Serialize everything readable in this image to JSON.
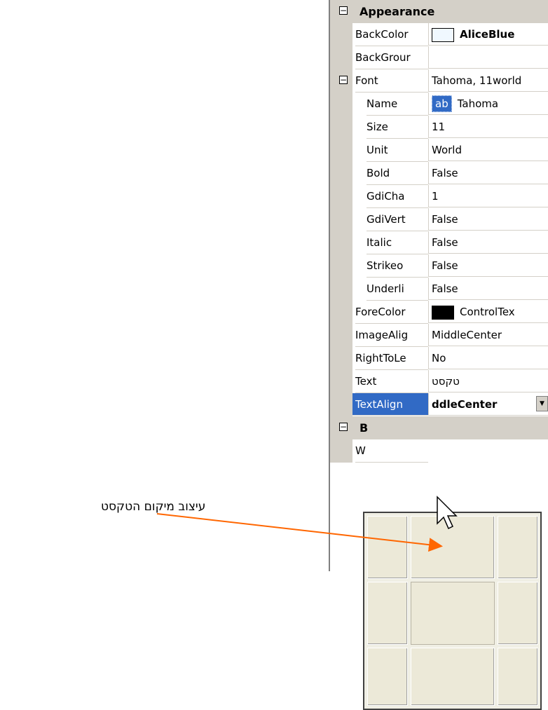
{
  "category_appearance": "Appearance",
  "properties": {
    "backcolor_name": "BackColor",
    "backcolor_value": "AliceBlue",
    "backcolor_swatch": "#f0f8ff",
    "backgroundimage_name": "BackGrour",
    "font_name": "Font",
    "font_value": "Tahoma, 11world",
    "name_name": "Name",
    "name_value": "Tahoma",
    "name_icon_text": "ab",
    "size_name": "Size",
    "size_value": "11",
    "unit_name": "Unit",
    "unit_value": "World",
    "bold_name": "Bold",
    "bold_value": "False",
    "gdichar_name": "GdiCha",
    "gdichar_value": "1",
    "gdivert_name": "GdiVert",
    "gdivert_value": "False",
    "italic_name": "Italic",
    "italic_value": "False",
    "strikeout_name": "Strikeo",
    "strikeout_value": "False",
    "underline_name": "Underli",
    "underline_value": "False",
    "forecolor_name": "ForeColor",
    "forecolor_value": "ControlTex",
    "forecolor_swatch": "#000000",
    "imagealign_name": "ImageAlig",
    "imagealign_value": "MiddleCenter",
    "righttoleft_name": "RightToLe",
    "righttoleft_value": "No",
    "text_name": "Text",
    "text_value": "טקסט",
    "textalign_name": "TextAlign",
    "textalign_value": "ddleCenter"
  },
  "category_behavior_partial": "B",
  "hidden_row_partial": "W",
  "annotation": "עיצוב מיקום הטקסט",
  "colors": {
    "selection": "#316ac5",
    "arrow": "#ff6600",
    "gutter": "#d4d0c8"
  }
}
